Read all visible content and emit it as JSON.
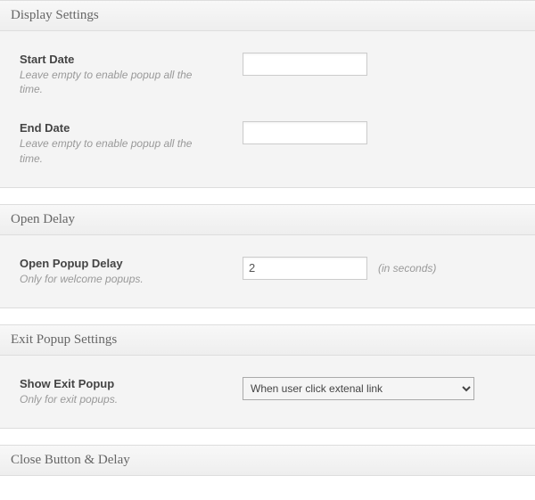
{
  "sections": {
    "display": {
      "title": "Display Settings",
      "start_date": {
        "label": "Start Date",
        "hint": "Leave empty to enable popup all the time.",
        "value": ""
      },
      "end_date": {
        "label": "End Date",
        "hint": "Leave empty to enable popup all the time.",
        "value": ""
      }
    },
    "open_delay": {
      "title": "Open Delay",
      "delay": {
        "label": "Open Popup Delay",
        "hint": "Only for welcome popups.",
        "value": "2",
        "suffix": "(in seconds)"
      }
    },
    "exit": {
      "title": "Exit Popup Settings",
      "show": {
        "label": "Show Exit Popup",
        "hint": "Only for exit popups.",
        "selected": "When user click extenal link"
      }
    },
    "close": {
      "title": "Close Button & Delay"
    }
  }
}
